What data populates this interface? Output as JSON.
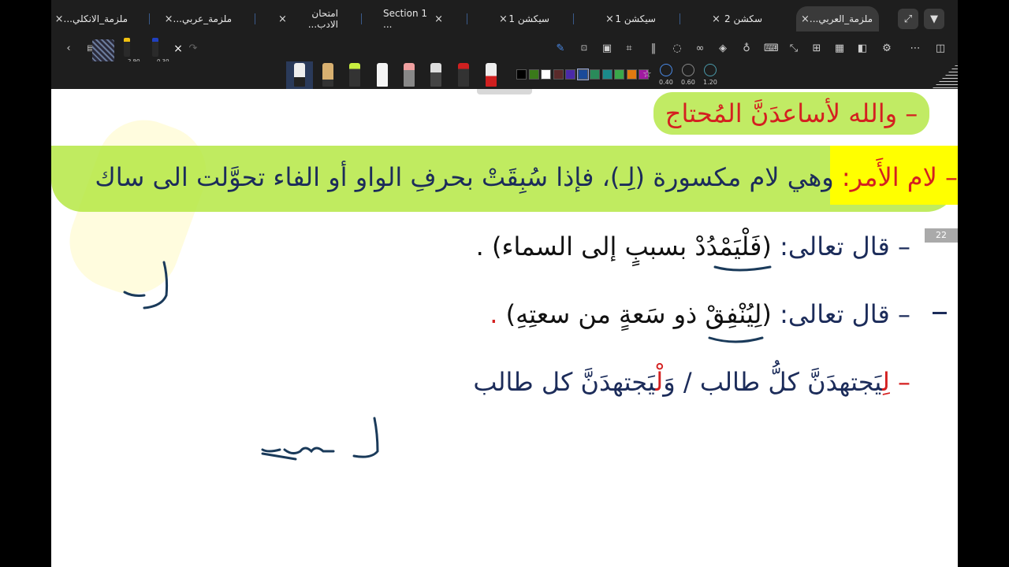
{
  "tabs": [
    {
      "label": "ملزمة_الانكلي...",
      "active": false
    },
    {
      "label": "ملزمة_عربي...",
      "active": false
    },
    {
      "label": "امتحان الادب...",
      "active": false
    },
    {
      "label": "Section 1 ...",
      "active": false
    },
    {
      "label": "سيكشن 1",
      "active": false
    },
    {
      "label": "سيكشن 1",
      "active": false
    },
    {
      "label": "سكشن 2",
      "active": false
    },
    {
      "label": "ملزمة_العربي...",
      "active": true
    }
  ],
  "close_glyph": "×",
  "pen_sizes_top": [
    "2.90",
    "0.30"
  ],
  "stroke_sizes": [
    "0.40",
    "0.60",
    "1.20"
  ],
  "palette": [
    "#000000",
    "#3a7a1a",
    "#ffffff",
    "#5a2a2a",
    "#4a2aa8",
    "#1a4a9a",
    "#2a8a5a",
    "#1a8a8a",
    "#3aa84a",
    "#e07a10",
    "#a01aa0"
  ],
  "page_number": "22",
  "doc": {
    "line1": "– والله لأساعدَنَّ المُحتاج",
    "line2_label": "– لام الأَمر:",
    "line2_text": " وهي لام مكسورة (لِـ)، فإذا سُبِقَتْ بحرفِ الواو أو الفاء تحوَّلت الى ساك",
    "line3_prefix": "– قال تعالى: ",
    "line3_text": "(فَلْيَمْدُدْ بسببٍ إلى السماء) .",
    "line4_prefix": "– قال تعالى: ",
    "line4_text": "(لِيُنْفِقْ ذو سَعةٍ من سعتِهِ)",
    "line4_dot": ".",
    "line5_a": "– لِ",
    "line5_b": "يَجتهدَنَّ كلُّ طالب  /  وَ",
    "line5_c": "لْ",
    "line5_d": "يَجتهدَنَّ كل طالب"
  },
  "colors": {
    "highlight": "#b0e638",
    "red_text": "#d42020",
    "navy_text": "#1c2c5a",
    "yellow_box": "#ffff00",
    "ink": "#1a3a5a"
  }
}
